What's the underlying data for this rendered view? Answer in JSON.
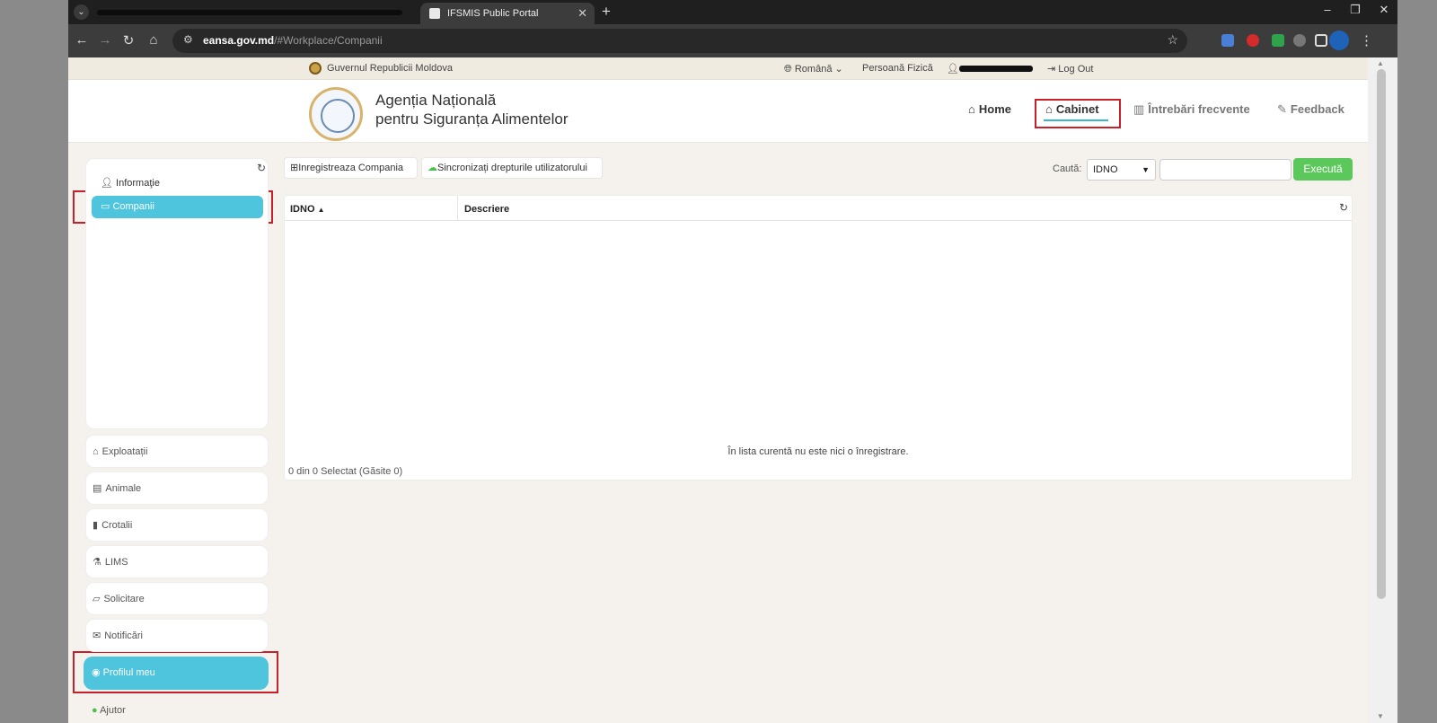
{
  "browser": {
    "active_tab_title": "IFSMIS Public Portal",
    "tab_close": "✕",
    "new_tab": "+",
    "url_host": "eansa.gov.md",
    "url_path": "/#Workplace/Companii",
    "window_controls": [
      "–",
      "❐",
      "✕"
    ]
  },
  "topbar": {
    "government": "Guvernul Republicii Moldova",
    "language": "Română",
    "persona": "Persoană Fizică",
    "logout": "Log Out"
  },
  "header": {
    "agency_line1": "Agenția Națională",
    "agency_line2": "pentru Siguranța Alimentelor",
    "nav": {
      "home": "Home",
      "cabinet": "Cabinet",
      "faq": "Întrebări frecvente",
      "feedback": "Feedback"
    }
  },
  "sidebar": {
    "info": "Informaţie",
    "active": "Companii",
    "items": [
      "Exploatații",
      "Animale",
      "Crotalii",
      "LIMS",
      "Solicitare",
      "Notificări"
    ],
    "profile": "Profilul meu",
    "help": "Ajutor"
  },
  "toolbar": {
    "register_label": "Inregistreaza Compania",
    "sync_label": "Sincronizați drepturile utilizatorului",
    "search_label": "Caută:",
    "search_field": "IDNO",
    "search_value": "",
    "execute_label": "Execută"
  },
  "grid": {
    "columns": [
      "IDNO",
      "Descriere"
    ],
    "sort_indicator": "▲",
    "empty_message": "În lista curentă nu este nici o înregistrare.",
    "footer": "0 din 0 Selectat (Găsite 0)"
  },
  "colors": {
    "accent": "#4ec5dc",
    "execute": "#5cc85c",
    "highlight": "#c8202a"
  }
}
